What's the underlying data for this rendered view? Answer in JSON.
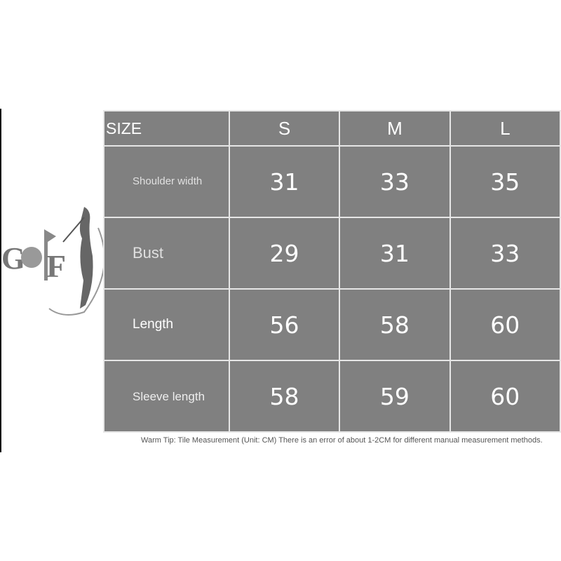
{
  "table": {
    "header": [
      "SIZE",
      "S",
      "M",
      "L"
    ],
    "rows": [
      {
        "label": "Shoulder width",
        "values": [
          "31",
          "33",
          "35"
        ]
      },
      {
        "label": "Bust",
        "values": [
          "29",
          "31",
          "33"
        ]
      },
      {
        "label": "Length",
        "values": [
          "56",
          "58",
          "60"
        ]
      },
      {
        "label": "Sleeve length",
        "values": [
          "58",
          "59",
          "60"
        ]
      }
    ]
  },
  "tip": "Warm Tip: Tile Measurement (Unit: CM) There is an error of about 1-2CM for different manual measurement methods.",
  "logo": {
    "text": "GOLF"
  },
  "colors": {
    "cell": "#808080",
    "border": "#e6e6e6"
  }
}
